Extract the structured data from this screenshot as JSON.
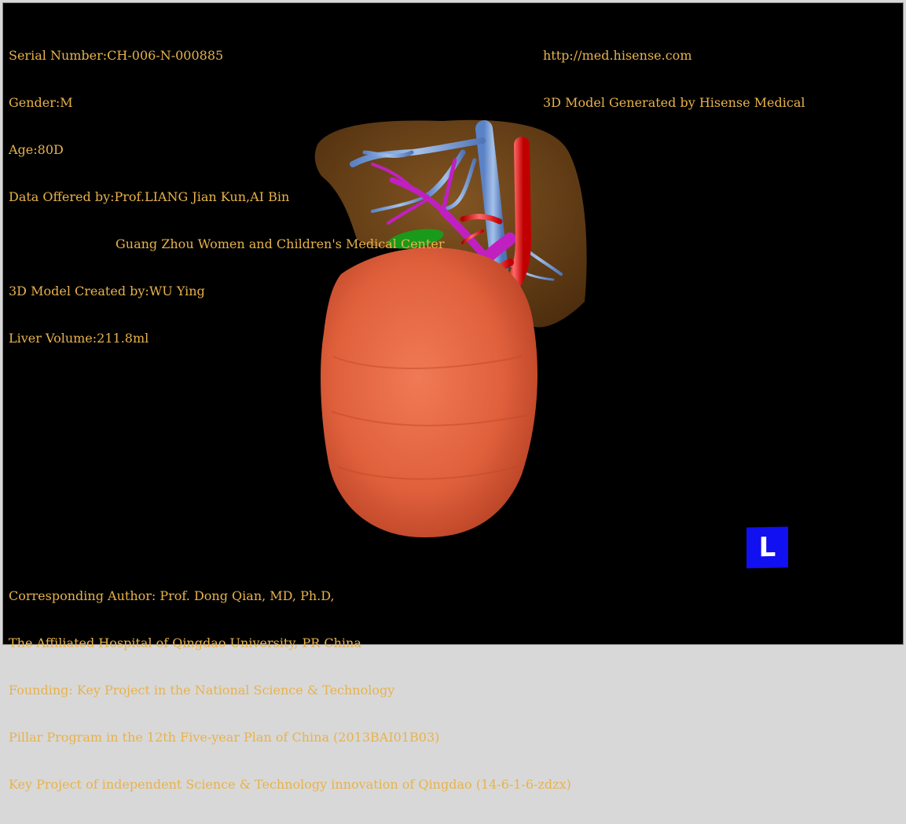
{
  "header_left": {
    "serial": "Serial Number:CH-006-N-000885",
    "gender": "Gender:M",
    "age": "Age:80D",
    "data_offered": "Data Offered by:Prof.LIANG Jian Kun,AI Bin",
    "institution": "Guang Zhou Women and Children's Medical Center",
    "model_created": "3D Model Created by:WU Ying",
    "liver_volume": "Liver Volume:211.8ml"
  },
  "header_right": {
    "url": "http://med.hisense.com",
    "generated_by": "3D Model Generated by Hisense Medical"
  },
  "footer_left": {
    "author": "Corresponding Author: Prof. Dong Qian, MD, Ph.D,",
    "hospital": "The Affiliated Hospital of Qingdao University, PR China",
    "founding": "Founding: Key Project in the National Science & Technology",
    "program": "Pillar Program in the 12th Five-year Plan of China (2013BAI01B03)",
    "key_project": "Key Project of independent Science & Technology innovation of Qingdao (14-6-1-6-zdzx)"
  },
  "orientation_label": "L",
  "colors": {
    "text": "#e8b24a",
    "liver": "#8a5520",
    "tumor": "#e0603c",
    "artery": "#e01818",
    "portal_vein": "#c020c0",
    "hepatic_vein": "#6f9be0",
    "gallbladder": "#1a8a1a",
    "orientation_cube": "#1010f0"
  }
}
